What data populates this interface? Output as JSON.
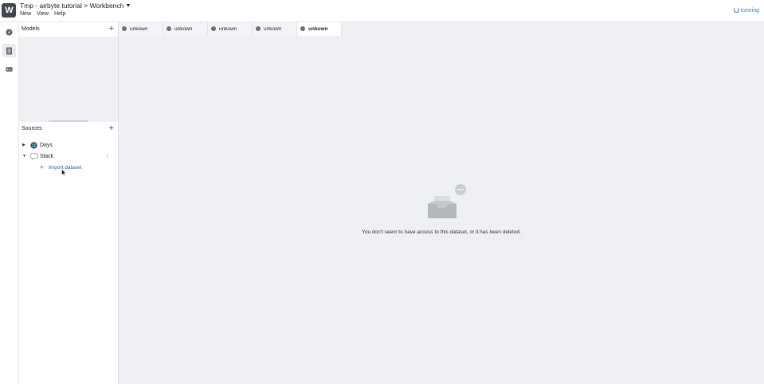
{
  "header": {
    "logo_text": "W",
    "breadcrumb": "Tmp - airbyte tutorial > Workbench",
    "menu": [
      "New",
      "View",
      "Help"
    ],
    "status": "running"
  },
  "rail": {
    "items": [
      "compass-icon",
      "list-icon",
      "terminal-icon"
    ]
  },
  "models": {
    "title": "Models",
    "add_icon": "plus-icon"
  },
  "sources": {
    "title": "Sources",
    "add_icon": "plus-icon",
    "items": [
      {
        "label": "Days",
        "icon": "globe-icon",
        "expanded": false
      },
      {
        "label": "Slack",
        "icon": "chat-icon",
        "expanded": true
      }
    ],
    "import_label": "Import dataset"
  },
  "tabs": [
    {
      "label": "unkown",
      "active": false
    },
    {
      "label": "unkown",
      "active": false
    },
    {
      "label": "unkown",
      "active": false
    },
    {
      "label": "unkown",
      "active": false
    },
    {
      "label": "unkown",
      "active": true
    }
  ],
  "main": {
    "message": "You don't seem to have access to this dataset, or it has been deleted."
  },
  "colors": {
    "accent": "#3a78c3",
    "panel_bg": "#eef0f4",
    "logo_bg": "#3f4650"
  }
}
